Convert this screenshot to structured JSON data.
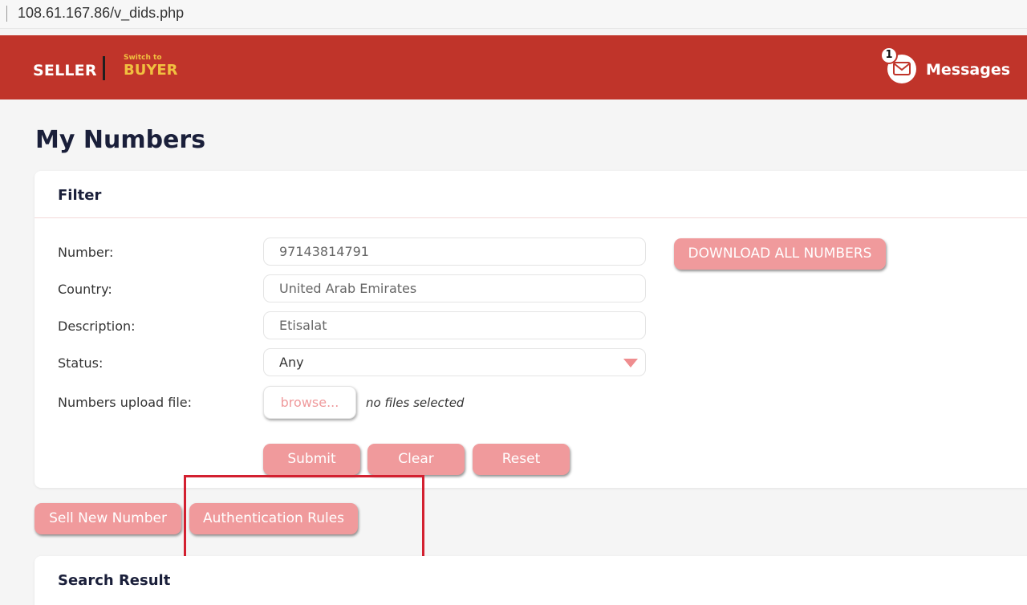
{
  "browser": {
    "url": "108.61.167.86/v_dids.php"
  },
  "header": {
    "role_label": "SELLER",
    "switch_label": "Switch to",
    "switch_target": "BUYER",
    "messages_label": "Messages",
    "messages_count": "1"
  },
  "page_title": "My Numbers",
  "filter": {
    "title": "Filter",
    "fields": {
      "number": {
        "label": "Number:",
        "value": "97143814791"
      },
      "country": {
        "label": "Country:",
        "value": "United Arab Emirates"
      },
      "description": {
        "label": "Description:",
        "value": "Etisalat"
      },
      "status": {
        "label": "Status:",
        "value": "Any"
      },
      "upload": {
        "label": "Numbers upload file:",
        "browse_label": "browse...",
        "file_status": "no files selected"
      }
    },
    "download_label": "DOWNLOAD ALL NUMBERS",
    "submit_label": "Submit",
    "clear_label": "Clear",
    "reset_label": "Reset"
  },
  "actions": {
    "sell_label": "Sell New Number",
    "auth_label": "Authentication Rules"
  },
  "search_result": {
    "title": "Search Result"
  },
  "colors": {
    "header": "#c0342a",
    "accent_yellow": "#f1c040",
    "button": "#f09a9c",
    "highlight": "#d32030"
  }
}
